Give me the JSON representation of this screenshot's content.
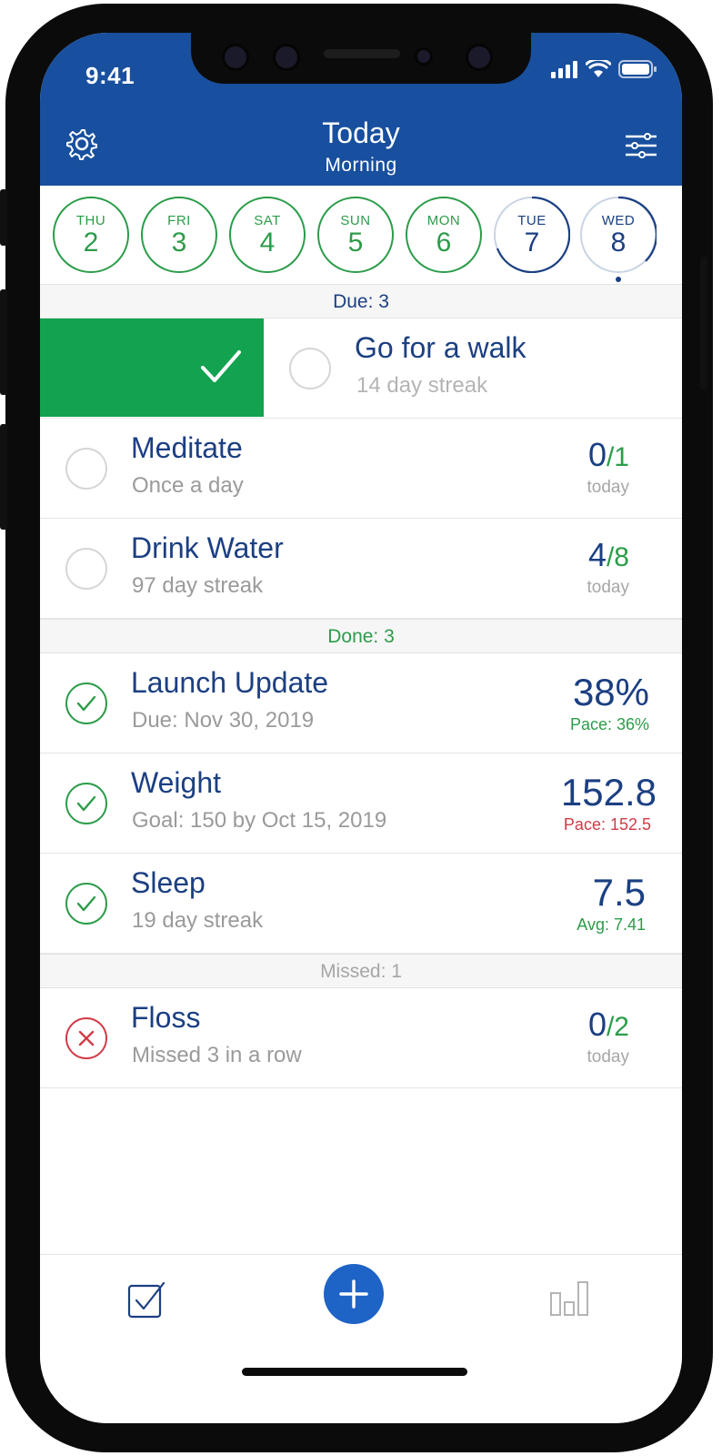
{
  "status_bar": {
    "time": "9:41"
  },
  "header": {
    "title": "Today",
    "subtitle": "Morning",
    "settings_icon": "gear-icon",
    "filter_icon": "sliders-icon"
  },
  "days": [
    {
      "name": "THU",
      "date": "2",
      "state": "done"
    },
    {
      "name": "FRI",
      "date": "3",
      "state": "done"
    },
    {
      "name": "SAT",
      "date": "4",
      "state": "done"
    },
    {
      "name": "SUN",
      "date": "5",
      "state": "done"
    },
    {
      "name": "MON",
      "date": "6",
      "state": "done"
    },
    {
      "name": "TUE",
      "date": "7",
      "state": "partial"
    },
    {
      "name": "WED",
      "date": "8",
      "state": "today"
    }
  ],
  "sections": {
    "due": "Due: 3",
    "done": "Done: 3",
    "missed": "Missed: 1"
  },
  "due_items": [
    {
      "name": "Go for a walk",
      "sub": "14 day streak"
    },
    {
      "name": "Meditate",
      "sub": "Once a day",
      "value": "0",
      "target": "/1",
      "unit": "today"
    },
    {
      "name": "Drink Water",
      "sub": "97 day streak",
      "value": "4",
      "target": "/8",
      "unit": "today"
    }
  ],
  "done_items": [
    {
      "name": "Launch Update",
      "sub": "Due: Nov 30, 2019",
      "value": "38%",
      "note": "Pace: 36%"
    },
    {
      "name": "Weight",
      "sub": "Goal: 150 by Oct 15, 2019",
      "value": "152.8",
      "note": "Pace: 152.5"
    },
    {
      "name": "Sleep",
      "sub": "19 day streak",
      "value": "7.5",
      "note": "Avg: 7.41"
    }
  ],
  "missed_items": [
    {
      "name": "Floss",
      "sub": "Missed 3 in a row",
      "value": "0",
      "target": "/2",
      "unit": "today"
    }
  ],
  "tabbar": {
    "left_icon": "checkbox-icon",
    "center_icon": "plus-icon",
    "right_icon": "bar-chart-icon"
  },
  "colors": {
    "header": "#184f9e",
    "green": "#2c9c4a",
    "swipe_green": "#12a250",
    "red": "#d13b47",
    "navy": "#1b3f82",
    "accent": "#1e63c6"
  }
}
